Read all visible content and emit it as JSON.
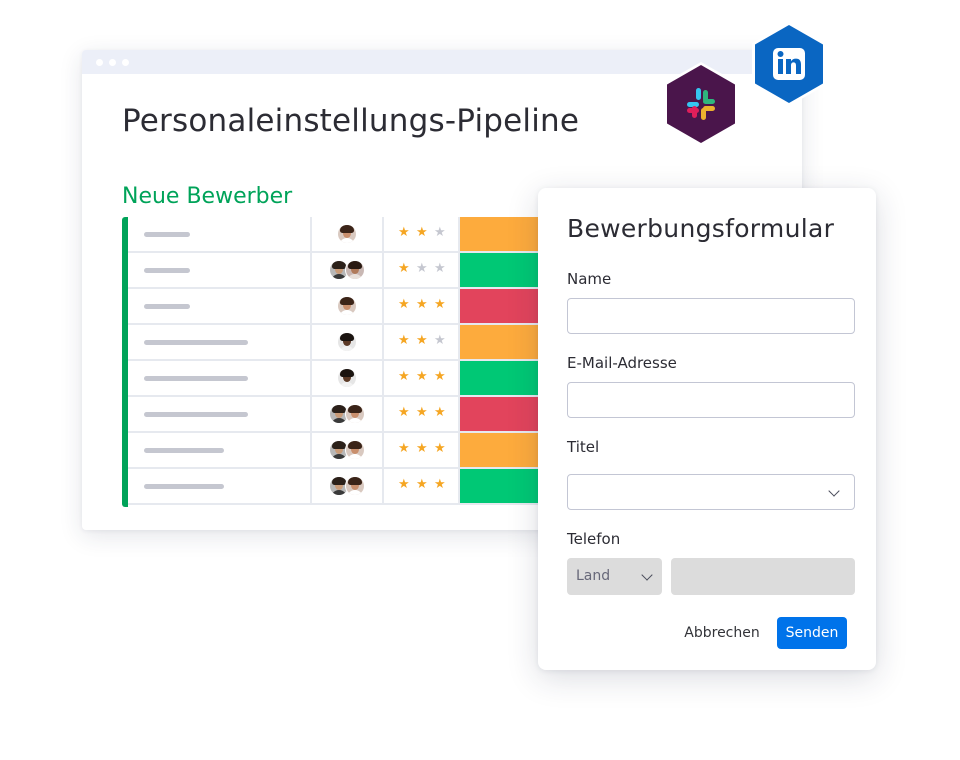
{
  "board": {
    "title": "Personaleinstellungs-Pipeline",
    "group_title": "Neue Bewerber",
    "group_color": "#00a359",
    "rows": [
      {
        "name_len": "short",
        "people": [
          "woman-curly"
        ],
        "rating": 2,
        "status_color": "#fdab3d"
      },
      {
        "name_len": "short",
        "people": [
          "man-beard",
          "woman-dark"
        ],
        "rating": 1,
        "status_color": "#00c875"
      },
      {
        "name_len": "short",
        "people": [
          "woman-curly"
        ],
        "rating": 3,
        "status_color": "#e2445c"
      },
      {
        "name_len": "long",
        "people": [
          "man-dark"
        ],
        "rating": 2,
        "status_color": "#fdab3d"
      },
      {
        "name_len": "long",
        "people": [
          "man-dark"
        ],
        "rating": 3,
        "status_color": "#00c875"
      },
      {
        "name_len": "long",
        "people": [
          "man-beard",
          "woman-curly"
        ],
        "rating": 3,
        "status_color": "#e2445c"
      },
      {
        "name_len": "medium",
        "people": [
          "man-beard",
          "woman-curly"
        ],
        "rating": 3,
        "status_color": "#fdab3d"
      },
      {
        "name_len": "medium",
        "people": [
          "man-beard",
          "woman-curly"
        ],
        "rating": 3,
        "status_color": "#00c875"
      }
    ],
    "star_on_color": "#f5a623",
    "star_off_color": "#c5c7d0",
    "star_glyph": "★"
  },
  "integrations": [
    {
      "name": "slack-icon",
      "color": "#4a154b"
    },
    {
      "name": "linkedin-icon",
      "color": "#0a66c2"
    }
  ],
  "form": {
    "title": "Bewerbungsformular",
    "name_label": "Name",
    "name_value": "",
    "email_label": "E-Mail-Adresse",
    "email_value": "",
    "title_label": "Titel",
    "title_value": "",
    "phone_label": "Telefon",
    "country_placeholder": "Land",
    "phone_value": "",
    "cancel_label": "Abbrechen",
    "submit_label": "Senden",
    "submit_color": "#0073ea"
  }
}
